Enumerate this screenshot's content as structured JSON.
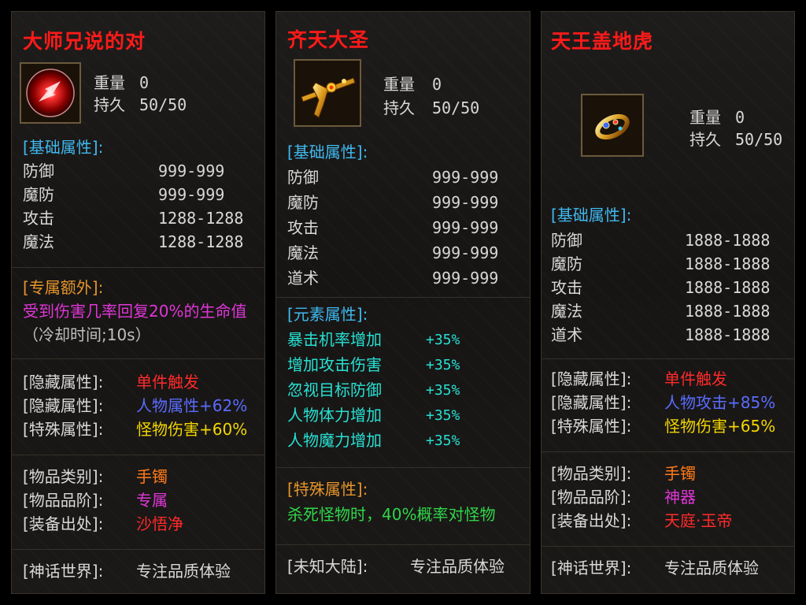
{
  "panel1": {
    "title": "大师兄说的对",
    "weight_label": "重量",
    "weight_value": "0",
    "durability_label": "持久",
    "durability_value": "50/50",
    "base_header": "[基础属性]:",
    "stats": [
      {
        "name": "防御",
        "value": "999-999"
      },
      {
        "name": "魔防",
        "value": "999-999"
      },
      {
        "name": "攻击",
        "value": "1288-1288"
      },
      {
        "name": "魔法",
        "value": "1288-1288"
      }
    ],
    "exclusive_header": "[专属额外]:",
    "exclusive_text": "受到伤害几率回复20%的生命值",
    "cooldown": "（冷却时间;10s）",
    "hidden1_label": "[隐藏属性]:",
    "hidden1_value": "单件触发",
    "hidden2_label": "[隐藏属性]:",
    "hidden2_value": "人物属性+62%",
    "special_label": "[特殊属性]:",
    "special_value": "怪物伤害+60%",
    "category_label": "[物品类别]:",
    "category_value": "手镯",
    "grade_label": "[物品品阶]:",
    "grade_value": "专属",
    "source_label": "[装备出处]:",
    "source_value": "沙悟净",
    "footer_label": "[神话世界]:",
    "footer_value": "专注品质体验"
  },
  "panel2": {
    "title": "齐天大圣",
    "weight_label": "重量",
    "weight_value": "0",
    "durability_label": "持久",
    "durability_value": "50/50",
    "base_header": "[基础属性]:",
    "stats": [
      {
        "name": "防御",
        "value": "999-999"
      },
      {
        "name": "魔防",
        "value": "999-999"
      },
      {
        "name": "攻击",
        "value": "999-999"
      },
      {
        "name": "魔法",
        "value": "999-999"
      },
      {
        "name": "道术",
        "value": "999-999"
      }
    ],
    "element_header": "[元素属性]:",
    "elements": [
      {
        "name": "暴击机率增加",
        "value": "+35%"
      },
      {
        "name": "增加攻击伤害",
        "value": "+35%"
      },
      {
        "name": "忽视目标防御",
        "value": "+35%"
      },
      {
        "name": "人物体力增加",
        "value": "+35%"
      },
      {
        "name": "人物魔力增加",
        "value": "+35%"
      }
    ],
    "special_header": "[特殊属性]:",
    "special_text": "杀死怪物时，40%概率对怪物",
    "footer_label": "[未知大陆]:",
    "footer_value": "专注品质体验"
  },
  "panel3": {
    "title": "天王盖地虎",
    "weight_label": "重量",
    "weight_value": "0",
    "durability_label": "持久",
    "durability_value": "50/50",
    "base_header": "[基础属性]:",
    "stats": [
      {
        "name": "防御",
        "value": "1888-1888"
      },
      {
        "name": "魔防",
        "value": "1888-1888"
      },
      {
        "name": "攻击",
        "value": "1888-1888"
      },
      {
        "name": "魔法",
        "value": "1888-1888"
      },
      {
        "name": "道术",
        "value": "1888-1888"
      }
    ],
    "hidden1_label": "[隐藏属性]:",
    "hidden1_value": "单件触发",
    "hidden2_label": "[隐藏属性]:",
    "hidden2_value": "人物攻击+85%",
    "special_label": "[特殊属性]:",
    "special_value": "怪物伤害+65%",
    "category_label": "[物品类别]:",
    "category_value": "手镯",
    "grade_label": "[物品品阶]:",
    "grade_value": "神器",
    "source_label": "[装备出处]:",
    "source_value": "天庭·玉帝",
    "footer_label": "[神话世界]:",
    "footer_value": "专注品质体验"
  }
}
